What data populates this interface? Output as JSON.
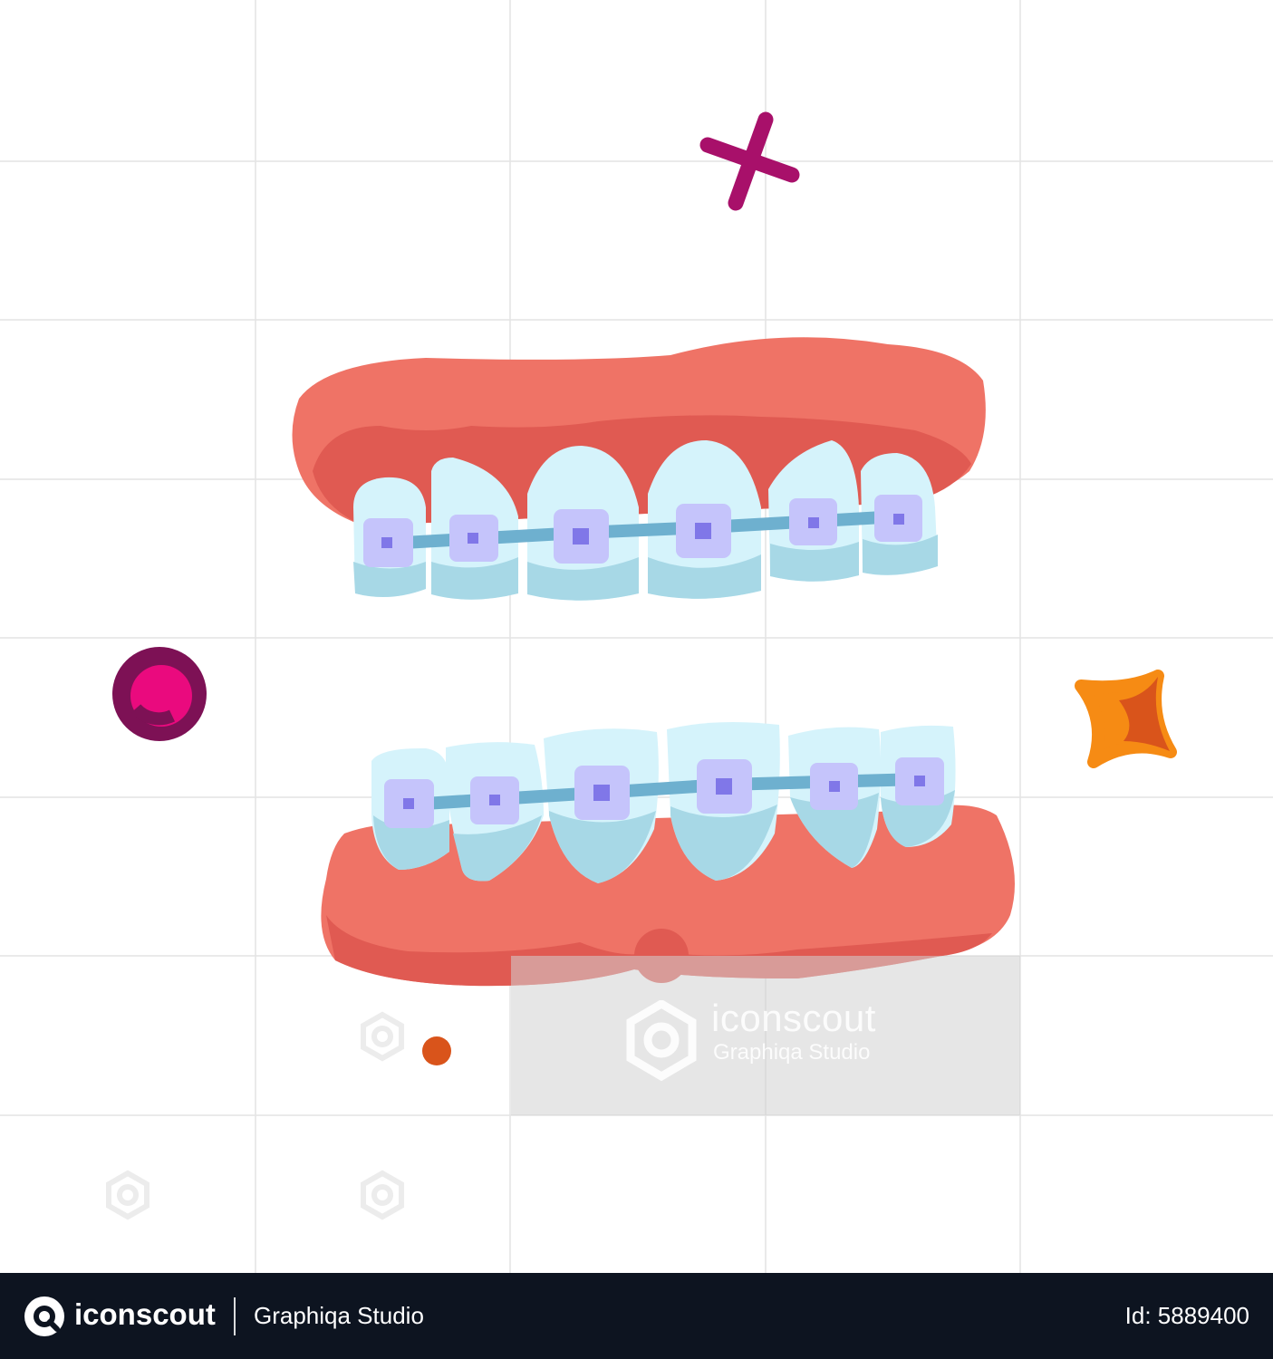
{
  "watermark": {
    "brand": "iconscout",
    "author": "Graphiqa Studio"
  },
  "footer": {
    "brand": "iconscout",
    "author": "Graphiqa Studio",
    "id_text": "Id: 5889400"
  },
  "illustration": {
    "subject": "teeth-with-braces",
    "colors": {
      "gum": "#ef7366",
      "gum_shadow": "#e05a52",
      "tooth": "#d5f3fb",
      "tooth_shadow": "#a7d8e6",
      "bracket": "#c5c4fb",
      "bracket_core": "#8077e8",
      "wire": "#6eb0cf",
      "cross": "#a8106a",
      "ring_outer": "#7d1155",
      "ring_inner": "#ea0a7e",
      "sparkle": "#f68b14",
      "sparkle_shadow": "#d9541b",
      "dot": "#d9541b",
      "grid": "#e3e3e3"
    }
  }
}
